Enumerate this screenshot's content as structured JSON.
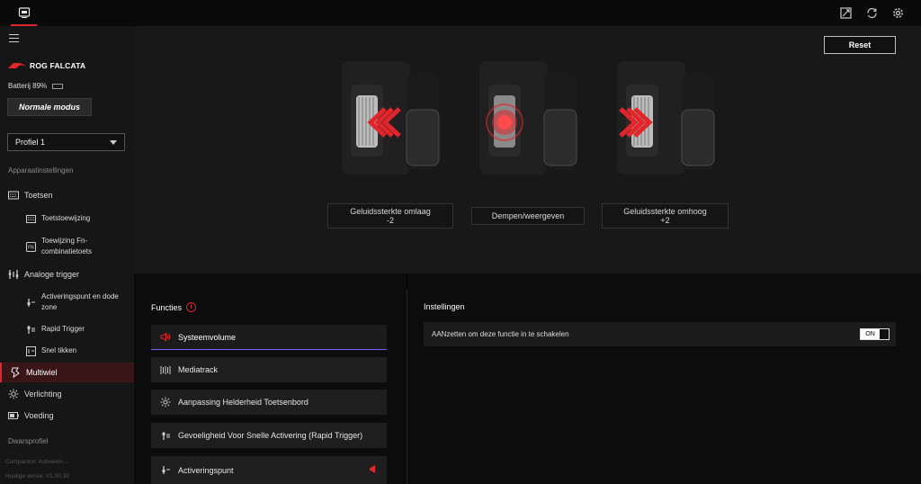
{
  "topbar": {
    "app_tab_icon": "device-icon",
    "icons": [
      "screenshot-icon",
      "sync-icon",
      "settings-gear-icon"
    ]
  },
  "sidebar": {
    "brand": "ROG FALCATA",
    "battery_label": "Batterij 89%",
    "battery_level": 0.89,
    "mode_button": "Normale modus",
    "profile_select": "Profiel 1",
    "section_device": "Apparaatinstellingen",
    "items": [
      {
        "label": "Toetsen",
        "icon": "keyboard-icon"
      },
      {
        "label": "Toetstoewijzing",
        "icon": "keymap-icon"
      },
      {
        "label": "Toewijzing Fn-combinatietoets",
        "icon": "fn-key-icon"
      },
      {
        "label": "Analoge trigger",
        "icon": "analog-trigger-icon"
      },
      {
        "label": "Activeringspunt en dode zone",
        "icon": "actuation-icon"
      },
      {
        "label": "Rapid Trigger",
        "icon": "rapid-trigger-icon"
      },
      {
        "label": "Snel tikken",
        "icon": "snap-tap-icon"
      },
      {
        "label": "Multiwiel",
        "icon": "multi-wheel-icon"
      },
      {
        "label": "Verlichting",
        "icon": "lighting-icon"
      },
      {
        "label": "Voeding",
        "icon": "power-icon"
      }
    ],
    "section_profile": "Dwarsprofiel",
    "companion": "Companion: Activeren...",
    "version": "Huidige versie: V1.00.32"
  },
  "visual": {
    "reset_label": "Reset",
    "actions": [
      {
        "line1": "Geluidssterkte omlaag",
        "line2": "-2"
      },
      {
        "line1": "Dempen/weergeven",
        "line2": ""
      },
      {
        "line1": "Geluidssterkte omhoog",
        "line2": "+2"
      }
    ]
  },
  "functions": {
    "title": "Functies",
    "items": [
      {
        "label": "Systeemvolume",
        "icon": "speaker-icon"
      },
      {
        "label": "Mediatrack",
        "icon": "media-track-icon"
      },
      {
        "label": "Aanpassing Helderheid Toetsenbord",
        "icon": "brightness-icon"
      },
      {
        "label": "Gevoeligheid Voor Snelle Activering (Rapid Trigger)",
        "icon": "rapid-trigger-icon"
      },
      {
        "label": "Activeringspunt",
        "icon": "actuation-icon"
      }
    ]
  },
  "settings": {
    "title": "Instellingen",
    "row_label": "AANzetten om deze functie in te schakelen",
    "toggle_label": "ON"
  },
  "colors": {
    "accent": "#e0262b",
    "active_underline": "#7a5cff",
    "battery": "#41c23b"
  }
}
